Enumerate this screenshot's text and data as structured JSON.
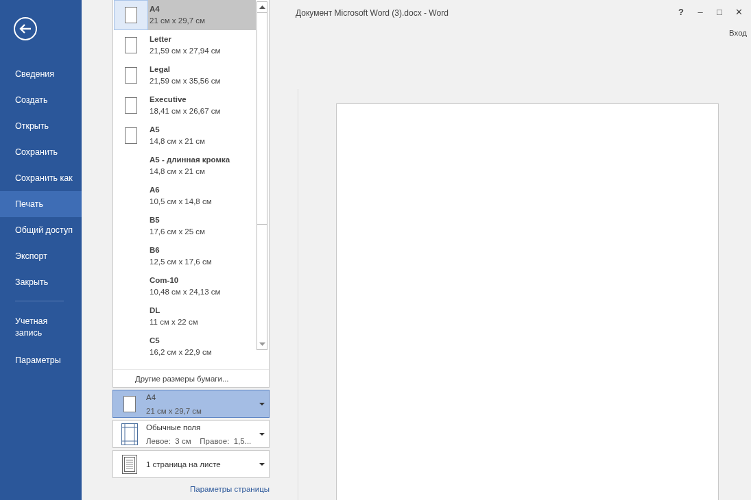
{
  "window": {
    "title": "Документ Microsoft Word (3).docx - Word",
    "sign_in": "Вход",
    "controls": [
      "?",
      "–",
      "□",
      "✕"
    ]
  },
  "sidebar": {
    "items": [
      {
        "label": "Сведения",
        "selected": false
      },
      {
        "label": "Создать",
        "selected": false
      },
      {
        "label": "Открыть",
        "selected": false
      },
      {
        "label": "Сохранить",
        "selected": false
      },
      {
        "label": "Сохранить как",
        "selected": false
      },
      {
        "label": "Печать",
        "selected": true
      },
      {
        "label": "Общий доступ",
        "selected": false
      },
      {
        "label": "Экспорт",
        "selected": false
      },
      {
        "label": "Закрыть",
        "selected": false
      },
      {
        "label": "Учетная запись",
        "selected": false,
        "separated": true
      },
      {
        "label": "Параметры",
        "selected": false
      }
    ]
  },
  "paper_menu": {
    "items": [
      {
        "name": "A4",
        "size": "21 см x 29,7 см",
        "kind": "page",
        "selected": true
      },
      {
        "name": "Letter",
        "size": "21,59 см x 27,94 см",
        "kind": "page",
        "selected": false
      },
      {
        "name": "Legal",
        "size": "21,59 см x 35,56 см",
        "kind": "page",
        "selected": false
      },
      {
        "name": "Executive",
        "size": "18,41 см x 26,67 см",
        "kind": "page",
        "selected": false
      },
      {
        "name": "A5",
        "size": "14,8 см x 21 см",
        "kind": "page",
        "selected": false
      },
      {
        "name": "A5 - длинная кромка",
        "size": "14,8 см x 21 см",
        "kind": "plain",
        "selected": false
      },
      {
        "name": "A6",
        "size": "10,5 см x 14,8 см",
        "kind": "plain",
        "selected": false
      },
      {
        "name": "B5",
        "size": "17,6 см x 25 см",
        "kind": "plain",
        "selected": false
      },
      {
        "name": "B6",
        "size": "12,5 см x 17,6 см",
        "kind": "plain",
        "selected": false
      },
      {
        "name": "Com-10",
        "size": "10,48 см x 24,13 см",
        "kind": "plain",
        "selected": false
      },
      {
        "name": "DL",
        "size": "11 см x 22 см",
        "kind": "plain",
        "selected": false
      },
      {
        "name": "C5",
        "size": "16,2 см x 22,9 см",
        "kind": "plain",
        "selected": false
      }
    ],
    "more": "Другие размеры бумаги..."
  },
  "settings": [
    {
      "kind": "paper",
      "title": "A4",
      "detail": "21 см x 29,7 см",
      "open": true
    },
    {
      "kind": "margins",
      "title": "Обычные поля",
      "detail": "Левое:  3 см    Правое:  1,5...",
      "open": false
    },
    {
      "kind": "pages",
      "title": "1 страница на листе",
      "open": false
    }
  ],
  "page_setup_link": "Параметры страницы"
}
